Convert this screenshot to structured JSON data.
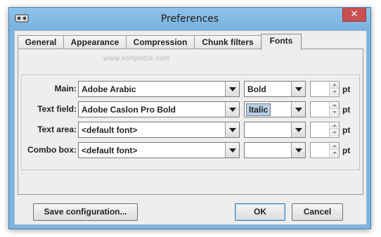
{
  "window": {
    "title": "Preferences",
    "close_glyph": "✕",
    "app_icon": "app-logo-icon"
  },
  "watermark": "www.softpedia.com",
  "tabs": [
    {
      "label": "General"
    },
    {
      "label": "Appearance"
    },
    {
      "label": "Compression"
    },
    {
      "label": "Chunk filters"
    },
    {
      "label": "Fonts"
    }
  ],
  "active_tab": "Fonts",
  "font_rows": [
    {
      "label": "Main:",
      "font": "Adobe Arabic",
      "style": "Bold",
      "size": "",
      "unit": "pt"
    },
    {
      "label": "Text field:",
      "font": "Adobe Caslon Pro Bold",
      "style": "Italic",
      "size": "",
      "unit": "pt"
    },
    {
      "label": "Text area:",
      "font": "<default font>",
      "style": "",
      "size": "",
      "unit": "pt"
    },
    {
      "label": "Combo box:",
      "font": "<default font>",
      "style": "",
      "size": "",
      "unit": "pt"
    }
  ],
  "buttons": {
    "save": "Save configuration...",
    "ok": "OK",
    "cancel": "Cancel"
  },
  "colors": {
    "title_bar": "#7fb5e0",
    "close_button": "#c75050",
    "selection_highlight": "#b8cfe8"
  }
}
